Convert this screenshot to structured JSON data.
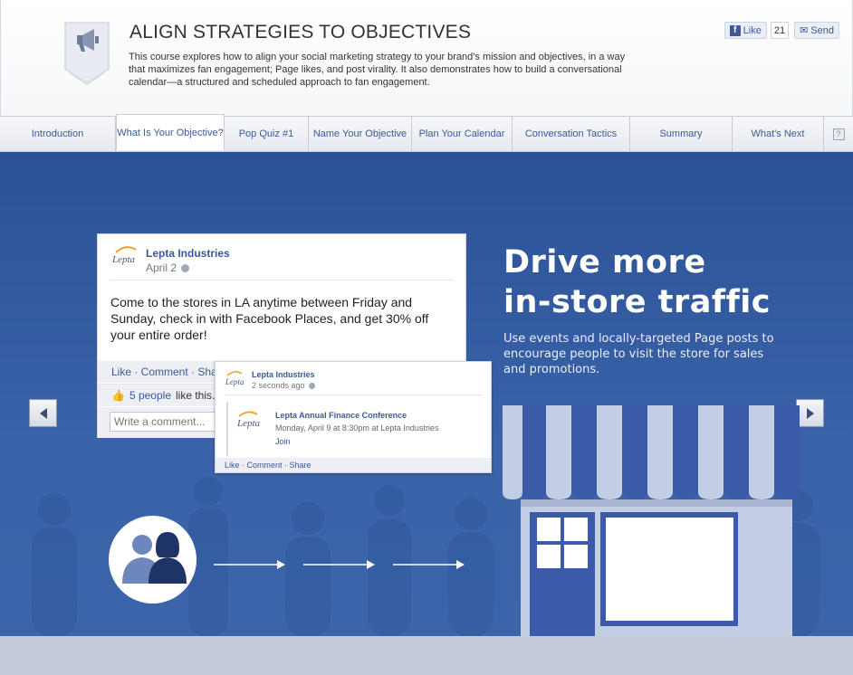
{
  "header": {
    "title": "ALIGN STRATEGIES TO OBJECTIVES",
    "description": "This course explores how to align your social marketing strategy to your brand's mission and objectives, in a way that maximizes fan engagement; Page likes, and post virality. It also demonstrates how to build a conversational calendar—a structured and scheduled approach to fan engagement.",
    "like_label": "Like",
    "like_count": "21",
    "send_label": "Send",
    "badge_icon": "megaphone-icon"
  },
  "tabs": [
    {
      "label": "Introduction"
    },
    {
      "label": "What Is Your Objective?"
    },
    {
      "label": "Pop Quiz #1"
    },
    {
      "label": "Name Your Objective"
    },
    {
      "label": "Plan Your Calendar"
    },
    {
      "label": "Conversation Tactics"
    },
    {
      "label": "Summary"
    },
    {
      "label": "What's Next"
    }
  ],
  "active_tab": "What Is Your Objective?",
  "help_icon": "?",
  "slide": {
    "headline_line1": "Drive more",
    "headline_line2": "in-store traffic",
    "subtext": "Use events and locally-targeted Page posts to encourage people to visit the store for sales and promotions.",
    "post": {
      "logo": "Lepta",
      "page_name": "Lepta Industries",
      "date": "April 2",
      "message": "Come to the stores in LA anytime between Friday and Sunday, check in with Facebook Places, and get 30% off your entire order!",
      "actions": "Like · Comment · Share",
      "likes_link": "5 people",
      "likes_suffix": "like this.",
      "comment_placeholder": "Write a comment..."
    },
    "event_post": {
      "logo": "Lepta",
      "page_name": "Lepta Industries",
      "time": "2 seconds ago",
      "event_logo": "Lepta",
      "event_title": "Lepta Annual Finance Conference",
      "event_when": "Monday, April 9 at 8:30pm at Lepta Industries",
      "join": "Join",
      "actions": "Like · Comment · Share"
    }
  },
  "colors": {
    "brand": "#3b5998",
    "stage_bg": "#2c5296",
    "store_blue": "#3b5ba8",
    "awning_light": "#c3cde3"
  }
}
